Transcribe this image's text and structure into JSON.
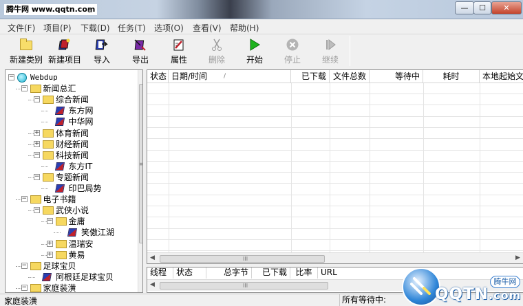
{
  "window": {
    "title": "腾牛网 www.qqtn.com",
    "title_tail": "a",
    "minimize_glyph": "—",
    "maximize_glyph": "☐",
    "close_glyph": "✕"
  },
  "menu": [
    "文件(F)",
    "项目(P)",
    "下载(D)",
    "任务(T)",
    "选项(O)",
    "查看(V)",
    "帮助(H)"
  ],
  "toolbar": [
    {
      "label": "新建类别",
      "icon": "folder-icon",
      "disabled": false
    },
    {
      "label": "新建项目",
      "icon": "new-item-icon",
      "disabled": false
    },
    {
      "label": "导入",
      "icon": "import-icon",
      "disabled": false
    },
    {
      "label": "导出",
      "icon": "export-icon",
      "disabled": false
    },
    {
      "label": "属性",
      "icon": "properties-icon",
      "disabled": false
    },
    {
      "label": "删除",
      "icon": "scissors-icon",
      "disabled": true
    },
    {
      "label": "开始",
      "icon": "play-icon",
      "disabled": false
    },
    {
      "label": "停止",
      "icon": "stop-icon",
      "disabled": true
    },
    {
      "label": "继续",
      "icon": "resume-icon",
      "disabled": true
    }
  ],
  "tree": [
    {
      "label": "Webdup",
      "level": 0,
      "icon": "globe-icon",
      "expander": "−"
    },
    {
      "label": "新闻总汇",
      "level": 1,
      "icon": "folder-icon",
      "expander": "−"
    },
    {
      "label": "综合新闻",
      "level": 2,
      "icon": "folder-icon",
      "expander": "−"
    },
    {
      "label": "东方网",
      "level": 3,
      "icon": "book-icon",
      "expander": ""
    },
    {
      "label": "中华网",
      "level": 3,
      "icon": "book-icon",
      "expander": ""
    },
    {
      "label": "体育新闻",
      "level": 2,
      "icon": "folder-icon",
      "expander": "+"
    },
    {
      "label": "财经新闻",
      "level": 2,
      "icon": "folder-icon",
      "expander": "+"
    },
    {
      "label": "科技新闻",
      "level": 2,
      "icon": "folder-icon",
      "expander": "−"
    },
    {
      "label": "东方IT",
      "level": 3,
      "icon": "book-icon",
      "expander": ""
    },
    {
      "label": "专题新闻",
      "level": 2,
      "icon": "folder-icon",
      "expander": "−"
    },
    {
      "label": "印巴局势",
      "level": 3,
      "icon": "book-icon",
      "expander": ""
    },
    {
      "label": "电子书籍",
      "level": 1,
      "icon": "folder-icon",
      "expander": "−"
    },
    {
      "label": "武侠小说",
      "level": 2,
      "icon": "folder-icon",
      "expander": "−"
    },
    {
      "label": "金庸",
      "level": 3,
      "icon": "folder-icon",
      "expander": "−"
    },
    {
      "label": "笑傲江湖",
      "level": 4,
      "icon": "book-icon",
      "expander": ""
    },
    {
      "label": "温瑞安",
      "level": 3,
      "icon": "folder-icon",
      "expander": "+"
    },
    {
      "label": "黄易",
      "level": 3,
      "icon": "folder-icon",
      "expander": "+"
    },
    {
      "label": "足球宝贝",
      "level": 1,
      "icon": "folder-icon",
      "expander": "−"
    },
    {
      "label": "阿根廷足球宝贝",
      "level": 2,
      "icon": "book-icon",
      "expander": ""
    },
    {
      "label": "家庭装潢",
      "level": 1,
      "icon": "folder-icon",
      "expander": "−"
    }
  ],
  "list": {
    "columns": [
      "状态",
      "日期/时间",
      "已下载",
      "文件总数",
      "等待中",
      "耗时",
      "本地起始文件"
    ],
    "sort_glyph": "/",
    "scroll_grip": "III"
  },
  "bottom_list": {
    "columns": [
      "线程",
      "状态",
      "总字节",
      "已下载",
      "比率",
      "URL"
    ],
    "scroll_grip": "III"
  },
  "status": {
    "left": "家庭装潢",
    "right": "所有等待中:"
  },
  "watermark": {
    "text": "QQTN",
    "suffix": ".com",
    "badge": "腾牛网"
  },
  "colors": {
    "play_green": "#1db31d",
    "stop_grey": "#a0a0a0",
    "folder_yellow": "#f7dd6a"
  }
}
